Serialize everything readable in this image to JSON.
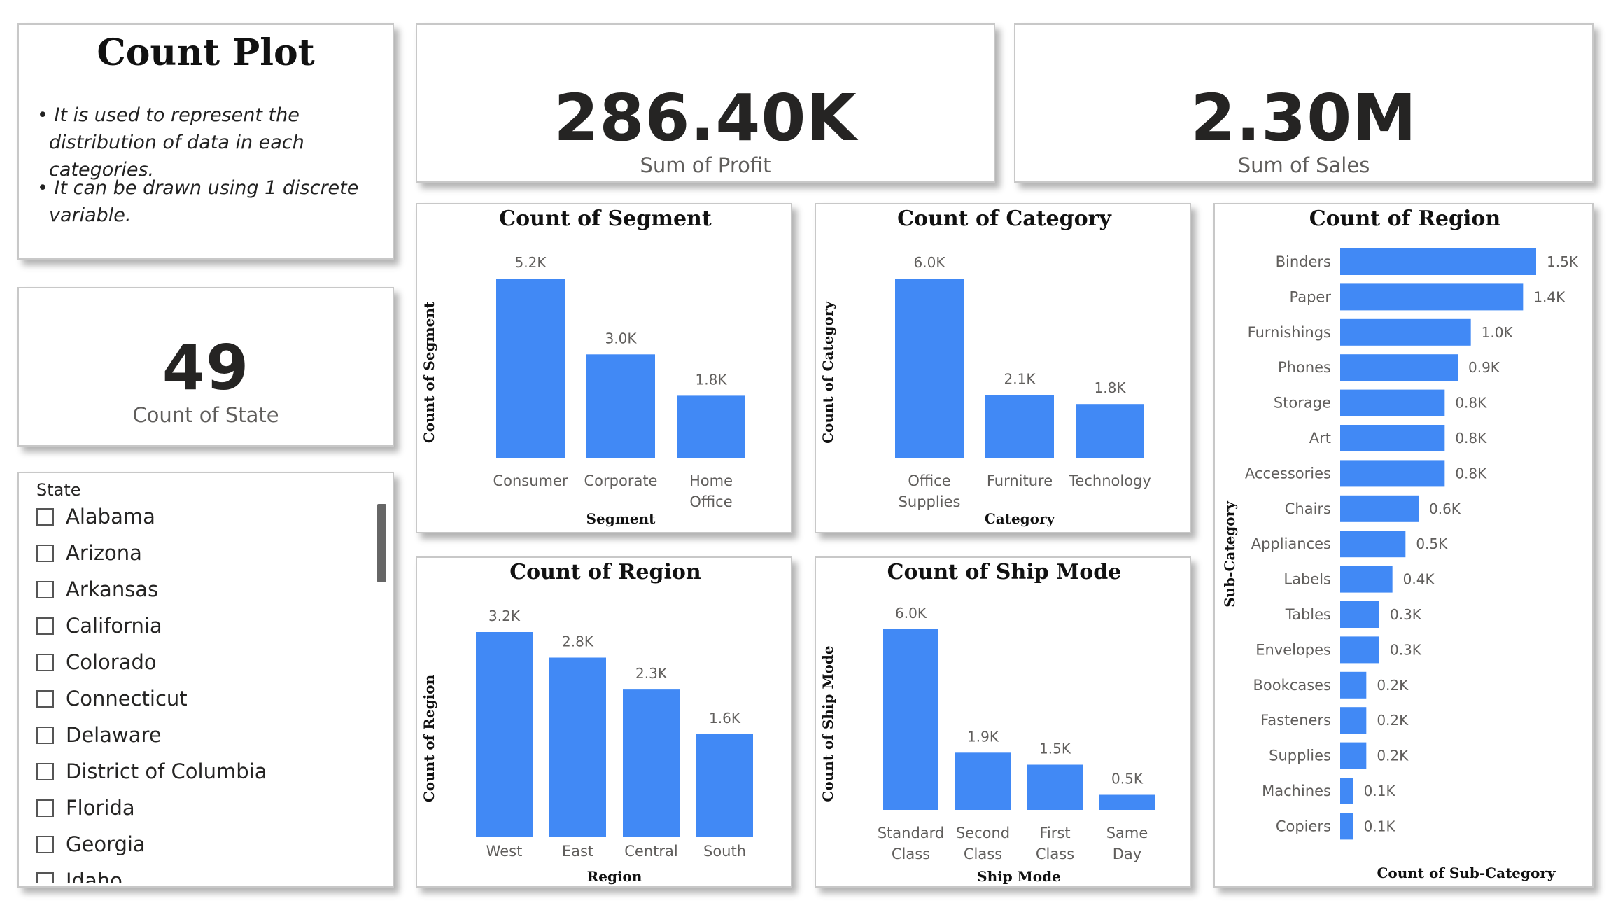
{
  "info": {
    "title": "Count Plot",
    "bullets": [
      "It is used to represent the distribution of data in each categories.",
      "It can be drawn using 1 discrete variable."
    ]
  },
  "kpis": {
    "profit": {
      "value": "286.40K",
      "label": "Sum of Profit"
    },
    "sales": {
      "value": "2.30M",
      "label": "Sum of Sales"
    },
    "state": {
      "value": "49",
      "label": "Count of State"
    }
  },
  "slicer": {
    "header": "State",
    "items": [
      "Alabama",
      "Arizona",
      "Arkansas",
      "California",
      "Colorado",
      "Connecticut",
      "Delaware",
      "District of Columbia",
      "Florida",
      "Georgia",
      "Idaho"
    ]
  },
  "colors": {
    "bar": "#4189f5",
    "axis_text": "#605e5c",
    "card_border": "#c8c8c8"
  },
  "chart_data": [
    {
      "id": "segment",
      "type": "bar",
      "title": "Count of Segment",
      "xlabel": "Segment",
      "ylabel": "Count of Segment",
      "categories": [
        [
          "Consumer"
        ],
        [
          "Corporate"
        ],
        [
          "Home",
          "Office"
        ]
      ],
      "values": [
        5200,
        3000,
        1800
      ],
      "data_labels": [
        "5.2K",
        "3.0K",
        "1.8K"
      ],
      "grid": false
    },
    {
      "id": "category",
      "type": "bar",
      "title": "Count of Category",
      "xlabel": "Category",
      "ylabel": "Count of Category",
      "categories": [
        [
          "Office",
          "Supplies"
        ],
        [
          "Furniture"
        ],
        [
          "Technology"
        ]
      ],
      "values": [
        6000,
        2100,
        1800
      ],
      "data_labels": [
        "6.0K",
        "2.1K",
        "1.8K"
      ],
      "grid": false
    },
    {
      "id": "region",
      "type": "bar",
      "title": "Count of Region",
      "xlabel": "Region",
      "ylabel": "Count of Region",
      "categories": [
        [
          "West"
        ],
        [
          "East"
        ],
        [
          "Central"
        ],
        [
          "South"
        ]
      ],
      "values": [
        3200,
        2800,
        2300,
        1600
      ],
      "data_labels": [
        "3.2K",
        "2.8K",
        "2.3K",
        "1.6K"
      ],
      "grid": false
    },
    {
      "id": "shipmode",
      "type": "bar",
      "title": "Count of Ship Mode",
      "xlabel": "Ship Mode",
      "ylabel": "Count of Ship Mode",
      "categories": [
        [
          "Standard",
          "Class"
        ],
        [
          "Second",
          "Class"
        ],
        [
          "First",
          "Class"
        ],
        [
          "Same",
          "Day"
        ]
      ],
      "values": [
        6000,
        1900,
        1500,
        500
      ],
      "data_labels": [
        "6.0K",
        "1.9K",
        "1.5K",
        "0.5K"
      ],
      "grid": false
    },
    {
      "id": "subcat",
      "type": "bar",
      "orientation": "horizontal",
      "title": "Count of Region",
      "xlabel": "Count of Sub-Category",
      "ylabel": "Sub-Category",
      "categories": [
        "Binders",
        "Paper",
        "Furnishings",
        "Phones",
        "Storage",
        "Art",
        "Accessories",
        "Chairs",
        "Appliances",
        "Labels",
        "Tables",
        "Envelopes",
        "Bookcases",
        "Fasteners",
        "Supplies",
        "Machines",
        "Copiers"
      ],
      "values": [
        1500,
        1400,
        1000,
        900,
        800,
        800,
        800,
        600,
        500,
        400,
        300,
        300,
        200,
        200,
        200,
        100,
        100
      ],
      "data_labels": [
        "1.5K",
        "1.4K",
        "1.0K",
        "0.9K",
        "0.8K",
        "0.8K",
        "0.8K",
        "0.6K",
        "0.5K",
        "0.4K",
        "0.3K",
        "0.3K",
        "0.2K",
        "0.2K",
        "0.2K",
        "0.1K",
        "0.1K"
      ],
      "grid": false
    }
  ]
}
